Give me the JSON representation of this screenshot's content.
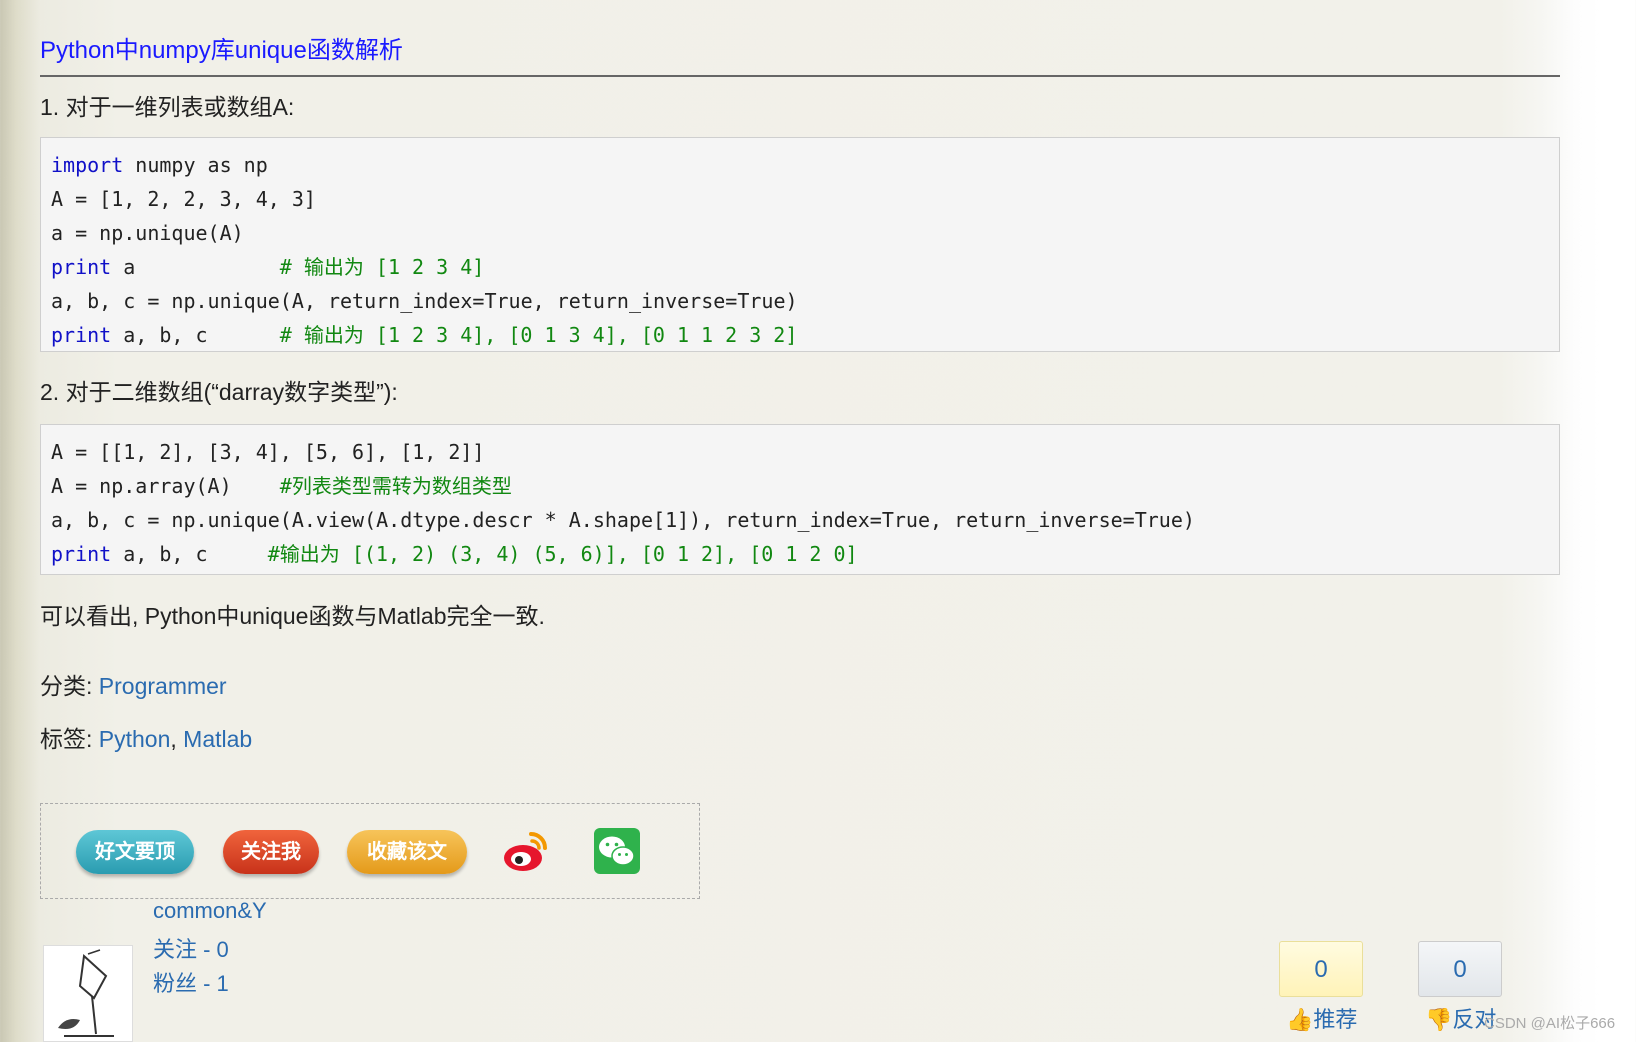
{
  "post": {
    "title": "Python中numpy库unique函数解析",
    "section1": "1. 对于一维列表或数组A:",
    "code1": [
      [
        {
          "t": "import",
          "c": "kw"
        },
        {
          "t": " numpy as np",
          "c": ""
        }
      ],
      [
        {
          "t": "A = [1, 2, 2, 3, 4, 3]",
          "c": ""
        }
      ],
      [
        {
          "t": "a = np.unique(A)",
          "c": ""
        }
      ],
      [
        {
          "t": "print",
          "c": "kw"
        },
        {
          "t": " a            ",
          "c": ""
        },
        {
          "t": "# 输出为 [1 2 3 4]",
          "c": "cm"
        }
      ],
      [
        {
          "t": "a, b, c = np.unique(A, return_index=True, return_inverse=True)",
          "c": ""
        }
      ],
      [
        {
          "t": "print",
          "c": "kw"
        },
        {
          "t": " a, b, c      ",
          "c": ""
        },
        {
          "t": "# 输出为 [1 2 3 4], [0 1 3 4], [0 1 1 2 3 2]",
          "c": "cm"
        }
      ]
    ],
    "section2": "2. 对于二维数组(“darray数字类型”):",
    "code2": [
      [
        {
          "t": "A = [[1, 2], [3, 4], [5, 6], [1, 2]]",
          "c": ""
        }
      ],
      [
        {
          "t": "A = np.array(A)    ",
          "c": ""
        },
        {
          "t": "#列表类型需转为数组类型",
          "c": "cm"
        }
      ],
      [
        {
          "t": "a, b, c = np.unique(A.view(A.dtype.descr * A.shape[1]), return_index=True, return_inverse=True)",
          "c": ""
        }
      ],
      [
        {
          "t": "print",
          "c": "kw"
        },
        {
          "t": " a, b, c     ",
          "c": ""
        },
        {
          "t": "#输出为 [(1, 2) (3, 4) (5, 6)], [0 1 2], [0 1 2 0]",
          "c": "cm"
        }
      ]
    ],
    "conclusion": "可以看出, Python中unique函数与Matlab完全一致."
  },
  "meta": {
    "category_label": "分类:",
    "category": "Programmer",
    "tags_label": "标签:",
    "tag1": "Python",
    "tag_sep": ", ",
    "tag2": "Matlab"
  },
  "share": {
    "top_label": "好文要顶",
    "follow_label": "关注我",
    "fav_label": "收藏该文",
    "weibo_icon": "weibo-icon",
    "wechat_icon": "wechat-icon"
  },
  "author": {
    "name": "common&Y",
    "following": "关注 - 0",
    "followers": "粉丝 - 1"
  },
  "votes": {
    "up_count": "0",
    "up_label": "推荐",
    "down_count": "0",
    "down_label": "反对"
  },
  "watermark": "CSDN @AI松子666",
  "colors": {
    "link": "#2a6bb0",
    "title": "#1a1aff",
    "keyword": "#1010c8",
    "comment": "#118811"
  }
}
